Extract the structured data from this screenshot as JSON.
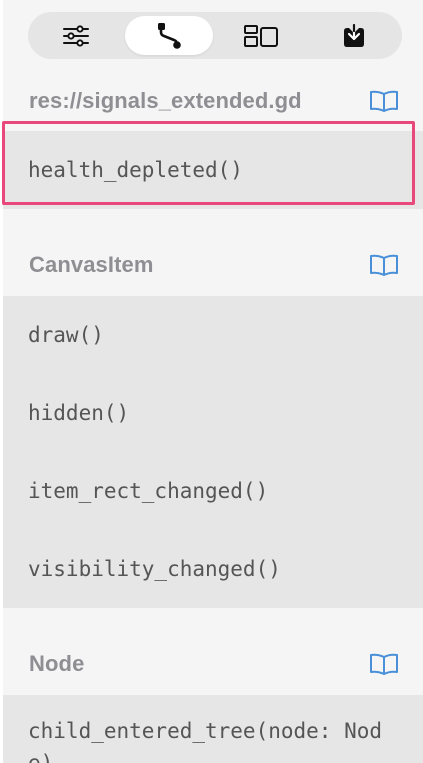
{
  "toolbar": {
    "buttons": [
      {
        "icon": "sliders-icon",
        "active": false
      },
      {
        "icon": "signal-connection-icon",
        "active": true
      },
      {
        "icon": "groups-icon",
        "active": false
      },
      {
        "icon": "import-icon",
        "active": false
      }
    ]
  },
  "sections": [
    {
      "title": "res://signals_extended.gd",
      "items": [
        "health_depleted()"
      ]
    },
    {
      "title": "CanvasItem",
      "items": [
        "draw()",
        "hidden()",
        "item_rect_changed()",
        "visibility_changed()"
      ]
    },
    {
      "title": "Node",
      "items": [
        "child_entered_tree(node: Node)"
      ]
    }
  ],
  "colors": {
    "accent_blue": "#4a90d9",
    "highlight": "#e8487b",
    "header_text": "#8e8e93",
    "item_text": "#555555",
    "list_bg": "#e6e6e6",
    "page_bg": "#f5f5f5"
  }
}
